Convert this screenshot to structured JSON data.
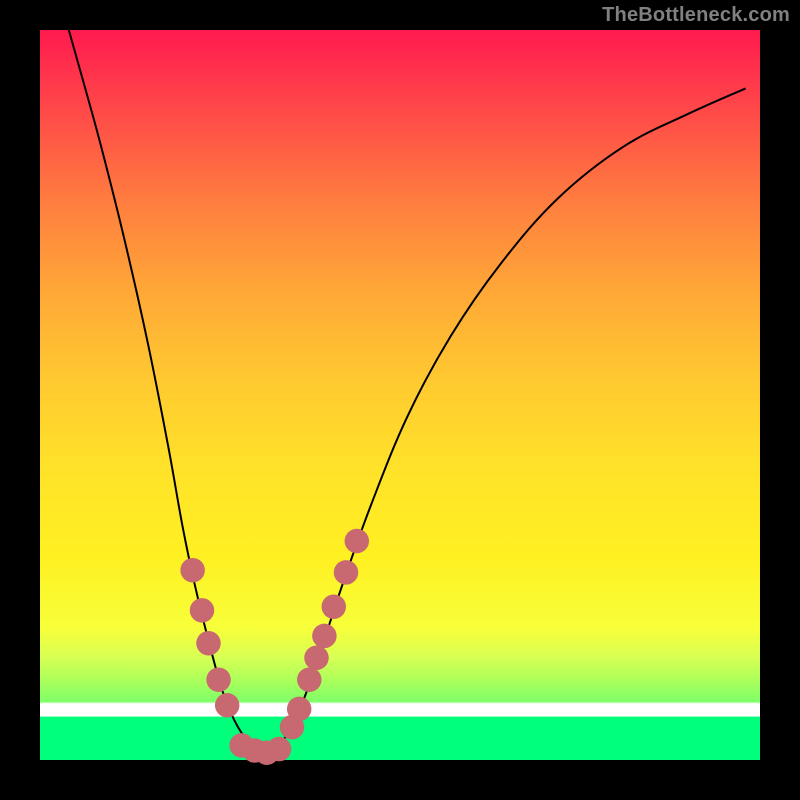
{
  "watermark": "TheBottleneck.com",
  "colors": {
    "background": "#000000",
    "dot": "#c86870",
    "curve_stroke": "#000000",
    "gradient_stops": [
      "#ff1a4f",
      "#ff4d48",
      "#ff7f3f",
      "#ffa837",
      "#ffc930",
      "#ffe229",
      "#fff022",
      "#f7ff3a",
      "#d7ff54",
      "#adff5a",
      "#7fff68",
      "#ffffff",
      "#00ff7a"
    ]
  },
  "chart_data": {
    "type": "line",
    "title": "",
    "xlabel": "",
    "ylabel": "",
    "x_range_normalized": [
      0,
      1
    ],
    "y_range_normalized": [
      0,
      1
    ],
    "curve": {
      "description": "V-shaped bottleneck curve. x is normalized position across plot width (0 left, 1 right), y is normalized height (0 bottom, 1 top).",
      "left_branch": [
        {
          "x": 0.04,
          "y": 1.0
        },
        {
          "x": 0.06,
          "y": 0.93
        },
        {
          "x": 0.085,
          "y": 0.84
        },
        {
          "x": 0.118,
          "y": 0.71
        },
        {
          "x": 0.15,
          "y": 0.57
        },
        {
          "x": 0.178,
          "y": 0.43
        },
        {
          "x": 0.198,
          "y": 0.32
        },
        {
          "x": 0.215,
          "y": 0.24
        },
        {
          "x": 0.235,
          "y": 0.16
        },
        {
          "x": 0.255,
          "y": 0.09
        },
        {
          "x": 0.275,
          "y": 0.045
        },
        {
          "x": 0.295,
          "y": 0.02
        },
        {
          "x": 0.315,
          "y": 0.01
        }
      ],
      "right_branch": [
        {
          "x": 0.315,
          "y": 0.01
        },
        {
          "x": 0.34,
          "y": 0.03
        },
        {
          "x": 0.365,
          "y": 0.08
        },
        {
          "x": 0.39,
          "y": 0.15
        },
        {
          "x": 0.42,
          "y": 0.24
        },
        {
          "x": 0.46,
          "y": 0.35
        },
        {
          "x": 0.51,
          "y": 0.47
        },
        {
          "x": 0.57,
          "y": 0.58
        },
        {
          "x": 0.64,
          "y": 0.68
        },
        {
          "x": 0.72,
          "y": 0.77
        },
        {
          "x": 0.81,
          "y": 0.84
        },
        {
          "x": 0.9,
          "y": 0.885
        },
        {
          "x": 0.98,
          "y": 0.92
        }
      ]
    },
    "dots": {
      "description": "Highlighted sample points near the valley, pink/coral capsules",
      "points": [
        {
          "x": 0.212,
          "y": 0.26
        },
        {
          "x": 0.225,
          "y": 0.205
        },
        {
          "x": 0.234,
          "y": 0.16
        },
        {
          "x": 0.248,
          "y": 0.11
        },
        {
          "x": 0.26,
          "y": 0.075
        },
        {
          "x": 0.28,
          "y": 0.02
        },
        {
          "x": 0.298,
          "y": 0.013
        },
        {
          "x": 0.315,
          "y": 0.01
        },
        {
          "x": 0.332,
          "y": 0.015
        },
        {
          "x": 0.35,
          "y": 0.045
        },
        {
          "x": 0.36,
          "y": 0.07
        },
        {
          "x": 0.374,
          "y": 0.11
        },
        {
          "x": 0.384,
          "y": 0.14
        },
        {
          "x": 0.395,
          "y": 0.17
        },
        {
          "x": 0.408,
          "y": 0.21
        },
        {
          "x": 0.425,
          "y": 0.257
        },
        {
          "x": 0.44,
          "y": 0.3
        }
      ],
      "radius_normalized": 0.017
    }
  }
}
